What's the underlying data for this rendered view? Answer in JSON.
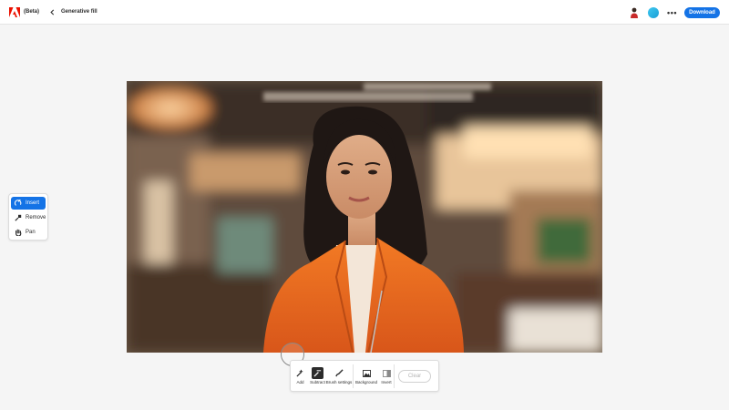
{
  "header": {
    "beta_label": "(Beta)",
    "title": "Generative fill",
    "download_label": "Download",
    "more_label": "•••"
  },
  "tools": [
    {
      "label": "Insert",
      "icon": "insert-icon",
      "active": true
    },
    {
      "label": "Remove",
      "icon": "remove-icon",
      "active": false
    },
    {
      "label": "Pan",
      "icon": "hand-icon",
      "active": false
    }
  ],
  "bottom_toolbar": {
    "add_label": "Add",
    "subtract_label": "Subtract",
    "brush_settings_label": "Brush settings",
    "background_label": "Background",
    "invert_label": "Invert",
    "clear_label": "Clear"
  },
  "colors": {
    "accent": "#1473e6",
    "jacket": "#ea6a1c"
  }
}
